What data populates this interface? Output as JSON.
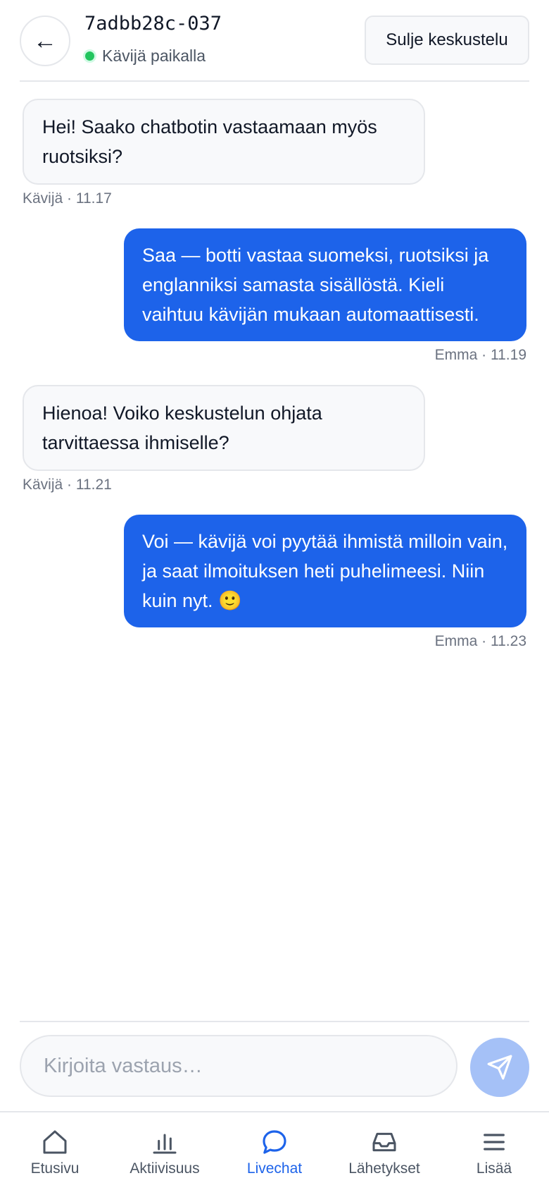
{
  "header": {
    "back_icon": "arrow-left-icon",
    "back_glyph": "←",
    "conversation_id": "7adbb28c-037",
    "presence_text": "Kävijä paikalla",
    "presence_color": "#22c55e",
    "close_label": "Sulje keskustelu"
  },
  "messages": [
    {
      "direction": "in",
      "text": "Hei! Saako chatbotin vastaamaan myös ruotsiksi?",
      "meta": "Kävijä · 11.17"
    },
    {
      "direction": "out",
      "text": "Saa — botti vastaa suomeksi, ruotsiksi ja englanniksi samasta sisällöstä. Kieli vaihtuu kävijän mukaan automaattisesti.",
      "meta": "Emma · 11.19"
    },
    {
      "direction": "in",
      "text": "Hienoa! Voiko keskustelun ohjata tarvittaessa ihmiselle?",
      "meta": "Kävijä · 11.21"
    },
    {
      "direction": "out",
      "text": "Voi — kävijä voi pyytää ihmistä milloin vain, ja saat ilmoituksen heti puhelimeesi. Niin kuin nyt. 🙂",
      "meta": "Emma · 11.23"
    }
  ],
  "composer": {
    "value": "",
    "placeholder": "Kirjoita vastaus…",
    "send_icon": "send-icon"
  },
  "nav": {
    "active": "livechat",
    "accent": "#1d63ea",
    "items": [
      {
        "id": "home",
        "label": "Etusivu",
        "icon": "home-icon"
      },
      {
        "id": "activity",
        "label": "Aktiivisuus",
        "icon": "bar-chart-icon"
      },
      {
        "id": "livechat",
        "label": "Livechat",
        "icon": "chat-bubble-icon"
      },
      {
        "id": "submissions",
        "label": "Lähetykset",
        "icon": "inbox-icon"
      },
      {
        "id": "more",
        "label": "Lisää",
        "icon": "menu-icon"
      }
    ]
  },
  "colors": {
    "outgoing_bubble": "#1d63ea",
    "incoming_bubble": "#f8f9fb",
    "send_button": "#a5c1f7"
  }
}
